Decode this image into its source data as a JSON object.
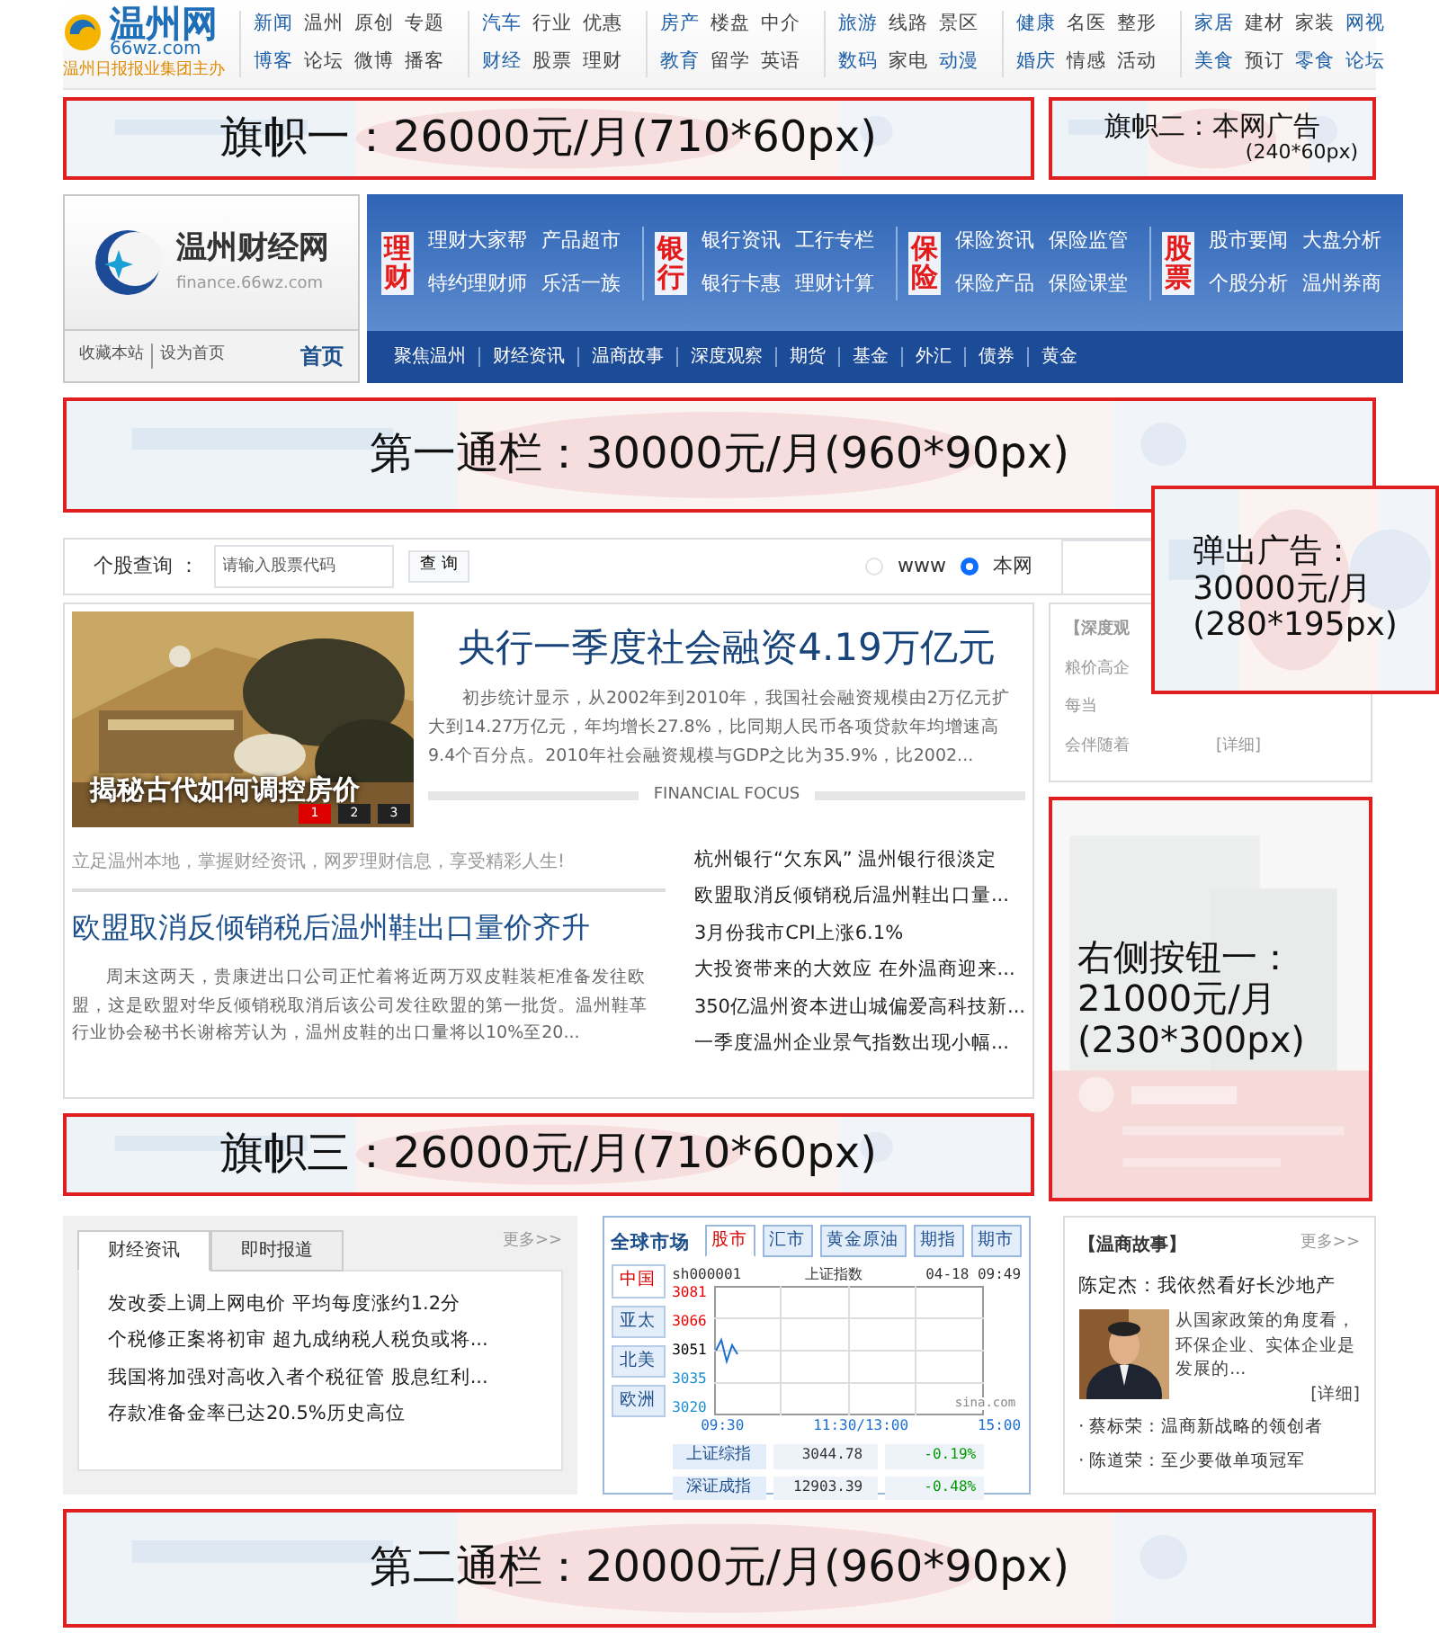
{
  "top_nav": {
    "logo": {
      "name": "温州网",
      "domain": "66wz.com",
      "tagline": "温州日报报业集团主办"
    },
    "groups": [
      {
        "rows": [
          [
            {
              "text": "新闻",
              "hot": true
            },
            {
              "text": "温州",
              "hot": false
            },
            {
              "text": "原创",
              "hot": false
            },
            {
              "text": "专题",
              "hot": false
            }
          ],
          [
            {
              "text": "博客",
              "hot": true
            },
            {
              "text": "论坛",
              "hot": false
            },
            {
              "text": "微博",
              "hot": false
            },
            {
              "text": "播客",
              "hot": false
            }
          ]
        ]
      },
      {
        "rows": [
          [
            {
              "text": "汽车",
              "hot": true
            },
            {
              "text": "行业",
              "hot": false
            },
            {
              "text": "优惠",
              "hot": false
            }
          ],
          [
            {
              "text": "财经",
              "hot": true
            },
            {
              "text": "股票",
              "hot": false
            },
            {
              "text": "理财",
              "hot": false
            }
          ]
        ]
      },
      {
        "rows": [
          [
            {
              "text": "房产",
              "hot": true
            },
            {
              "text": "楼盘",
              "hot": false
            },
            {
              "text": "中介",
              "hot": false
            }
          ],
          [
            {
              "text": "教育",
              "hot": true
            },
            {
              "text": "留学",
              "hot": false
            },
            {
              "text": "英语",
              "hot": false
            }
          ]
        ]
      },
      {
        "rows": [
          [
            {
              "text": "旅游",
              "hot": true
            },
            {
              "text": "线路",
              "hot": false
            },
            {
              "text": "景区",
              "hot": false
            }
          ],
          [
            {
              "text": "数码",
              "hot": true
            },
            {
              "text": "家电",
              "hot": false
            },
            {
              "text": "动漫",
              "hot": true
            }
          ]
        ]
      },
      {
        "rows": [
          [
            {
              "text": "健康",
              "hot": true
            },
            {
              "text": "名医",
              "hot": false
            },
            {
              "text": "整形",
              "hot": false
            }
          ],
          [
            {
              "text": "婚庆",
              "hot": true
            },
            {
              "text": "情感",
              "hot": false
            },
            {
              "text": "活动",
              "hot": false
            }
          ]
        ]
      },
      {
        "rows": [
          [
            {
              "text": "家居",
              "hot": true
            },
            {
              "text": "建材",
              "hot": false
            },
            {
              "text": "家装",
              "hot": false
            },
            {
              "text": "网视",
              "hot": true
            }
          ],
          [
            {
              "text": "美食",
              "hot": true
            },
            {
              "text": "预订",
              "hot": false
            },
            {
              "text": "零食",
              "hot": true
            },
            {
              "text": "论坛",
              "hot": true
            }
          ]
        ]
      }
    ]
  },
  "banner_row": [
    {
      "label": "旗帜一：26000元/月(710*60px)"
    },
    {
      "label": "旗帜二：本网广告",
      "size": "(240*60px)"
    }
  ],
  "finance_header": {
    "logo": {
      "name": "温州财经网",
      "domain": "finance.66wz.com"
    },
    "categories": [
      {
        "title": "理财",
        "links": [
          "理财大家帮",
          "产品超市",
          "特约理财师",
          "乐活一族"
        ]
      },
      {
        "title": "银行",
        "links": [
          "银行资讯",
          "工行专栏",
          "银行卡惠",
          "理财计算"
        ]
      },
      {
        "title": "保险",
        "links": [
          "保险资讯",
          "保险监管",
          "保险产品",
          "保险课堂"
        ]
      },
      {
        "title": "股票",
        "links": [
          "股市要闻",
          "大盘分析",
          "个股分析",
          "温州券商"
        ]
      }
    ],
    "tools": [
      "收藏本站",
      "设为首页"
    ],
    "home": "首页",
    "subnav": [
      "聚焦温州",
      "财经资讯",
      "温商故事",
      "深度观察",
      "期货",
      "基金",
      "外汇",
      "债券",
      "黄金"
    ]
  },
  "banner_1": {
    "label": "第一通栏：30000元/月(960*90px)"
  },
  "search": {
    "label": "个股查询 ：",
    "placeholder": "请输入股票代码",
    "button": "查 询",
    "scopes": [
      {
        "label": "www",
        "selected": false
      },
      {
        "label": "本网",
        "selected": true
      }
    ]
  },
  "focus": {
    "slide_caption": "揭秘古代如何调控房价",
    "pager": [
      {
        "label": "1",
        "selected": true
      },
      {
        "label": "2",
        "selected": false
      },
      {
        "label": "3",
        "selected": false
      }
    ],
    "headline": "央行一季度社会融资4.19万亿元",
    "summary": "初步统计显示，从2002年到2010年，我国社会融资规模由2万亿元扩大到14.27万亿元，年均增长27.8%，比同期人民币各项贷款年均增速高9.4个百分点。2010年社会融资规模与GDP之比为35.9%，比2002...",
    "divider": "FINANCIAL FOCUS",
    "slogan": "立足温州本地，掌握财经资讯，网罗理财信息，享受精彩人生!",
    "story_title": "欧盟取消反倾销税后温州鞋出口量价齐升",
    "story_text": "周末这两天，贵康进出口公司正忙着将近两万双皮鞋装柜准备发往欧盟，这是欧盟对华反倾销税取消后该公司发往欧盟的第一批货。温州鞋革行业协会秘书长谢榕芳认为，温州皮鞋的出口量将以10%至20...",
    "headlines": [
      "杭州银行“欠东风” 温州银行很淡定",
      "欧盟取消反倾销税后温州鞋出口量...",
      "3月份我市CPI上涨6.1%",
      "大投资带来的大效应 在外温商迎来...",
      "350亿温州资本进山城偏爱高科技新...",
      "一季度温州企业景气指数出现小幅..."
    ]
  },
  "banner_3": {
    "label": "旗帜三：26000元/月(710*60px)"
  },
  "deep_view": {
    "title": "【深度观",
    "lead": "粮价高企",
    "text_1": "每当",
    "text_2": "会伴随着",
    "more": "[详细]"
  },
  "side_ad": {
    "label": "右侧按钮一：\n21000元/月\n(230*300px)"
  },
  "popup_ad": {
    "label": "弹出广告：\n30000元/月\n(280*195px)"
  },
  "news_tabs": {
    "tabs": [
      {
        "label": "财经资讯",
        "selected": true
      },
      {
        "label": "即时报道",
        "selected": false
      }
    ],
    "more": "更多>>",
    "items": [
      "发改委上调上网电价 平均每度涨约1.2分",
      "个税修正案将初审 超九成纳税人税负或将...",
      "我国将加强对高收入者个税征管 股息红利...",
      "存款准备金率已达20.5%历史高位"
    ]
  },
  "market": {
    "title": "全球市场",
    "tabs": [
      {
        "label": "股市",
        "selected": true
      },
      {
        "label": "汇市",
        "selected": false
      },
      {
        "label": "黄金原油",
        "selected": false
      },
      {
        "label": "期指",
        "selected": false
      },
      {
        "label": "期市",
        "selected": false
      }
    ],
    "regions": [
      {
        "label": "中国",
        "selected": true
      },
      {
        "label": "亚太",
        "selected": false
      },
      {
        "label": "北美",
        "selected": false
      },
      {
        "label": "欧洲",
        "selected": false
      }
    ],
    "code": "sh000001",
    "index_name": "上证指数",
    "time": "04-18 09:49",
    "y_ticks": [
      {
        "label": "3081",
        "kind": "up"
      },
      {
        "label": "3066",
        "kind": "up"
      },
      {
        "label": "3051",
        "kind": "flat"
      },
      {
        "label": "3035",
        "kind": "down"
      },
      {
        "label": "3020",
        "kind": "down"
      }
    ],
    "x_ticks": [
      "09:30",
      "11:30/13:00",
      "15:00"
    ],
    "source": "sina.com",
    "quotes": [
      {
        "name": "上证综指",
        "value": "3044.78",
        "change": "-0.19%"
      },
      {
        "name": "深证成指",
        "value": "12903.39",
        "change": "-0.48%"
      }
    ]
  },
  "stories": {
    "title": "【温商故事】",
    "more": "更多>>",
    "headline": "陈定杰：我依然看好长沙地产",
    "text": "从国家政策的角度看，环保企业、实体企业是发展的...",
    "detail": "[详细]",
    "items": [
      "· 蔡标荣：温商新战略的领创者",
      "· 陈道荣：至少要做单项冠军"
    ]
  },
  "banner_2": {
    "label": "第二通栏：20000元/月(960*90px)"
  }
}
